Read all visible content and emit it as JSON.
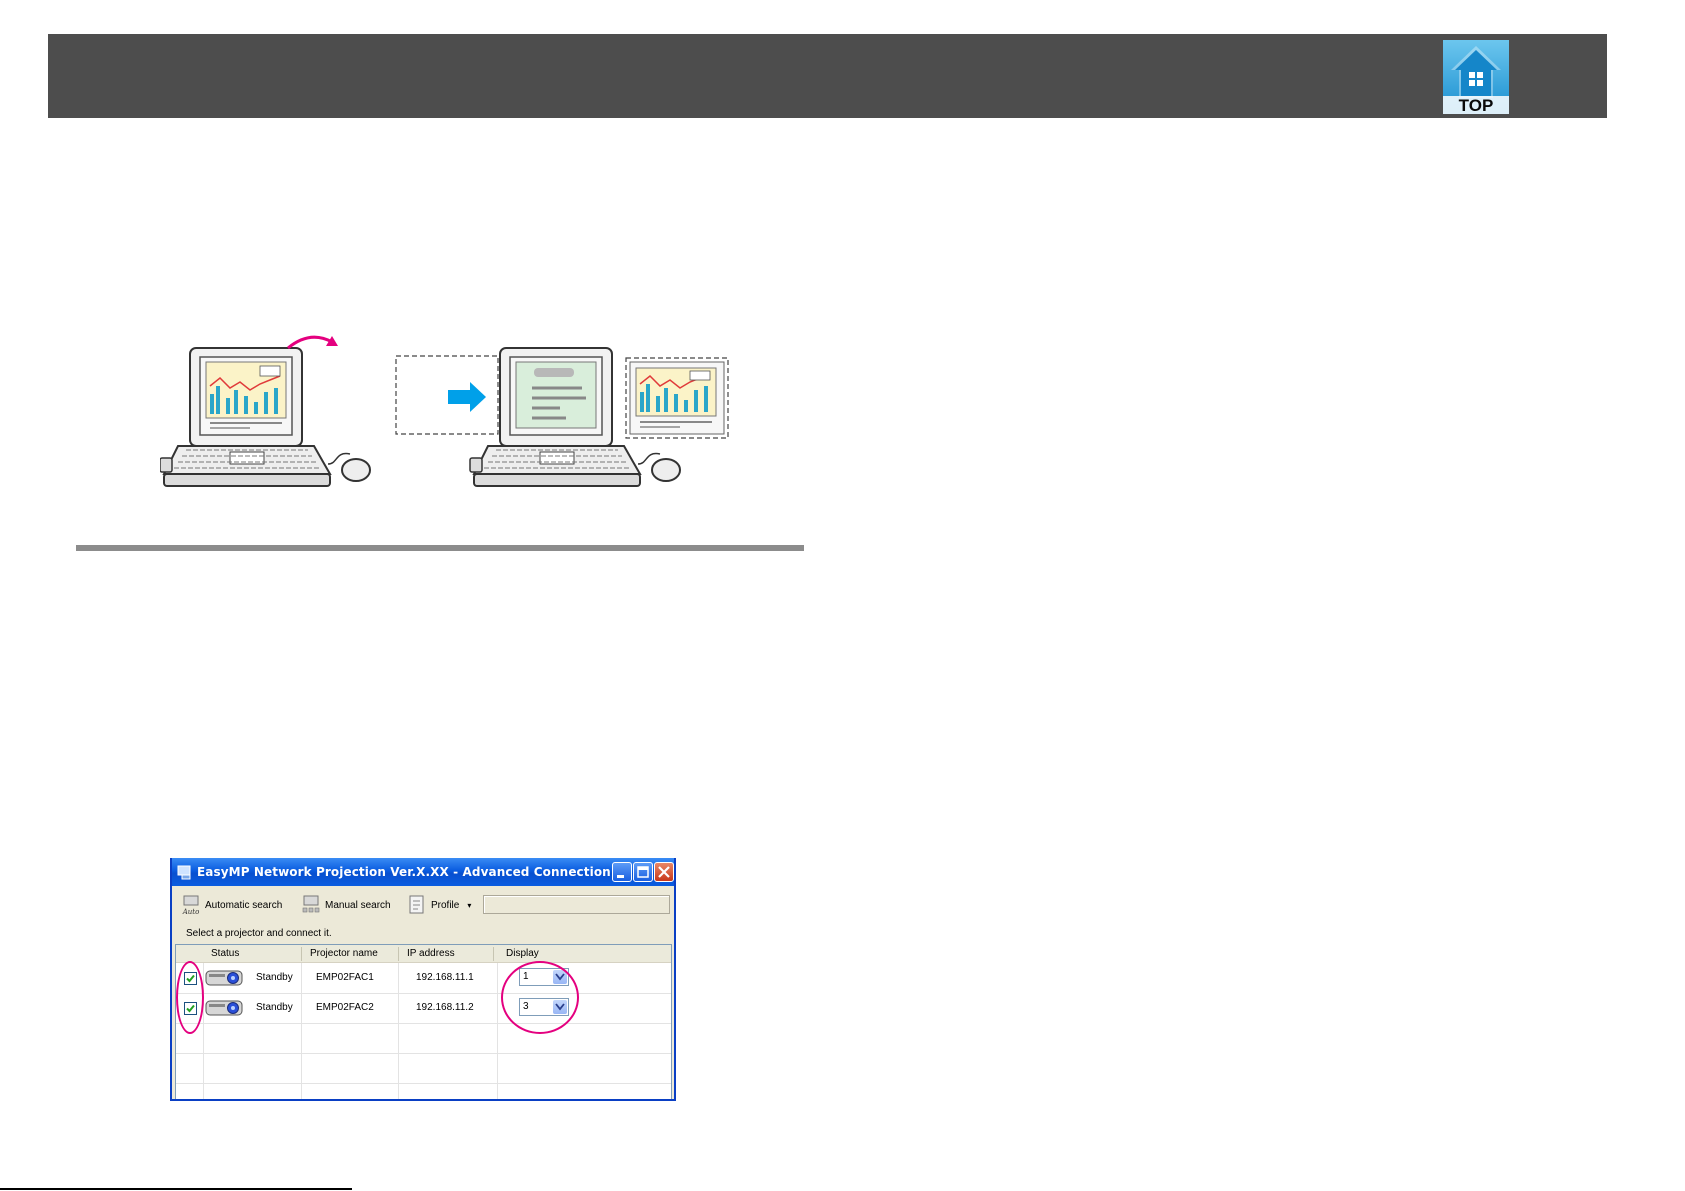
{
  "header": {
    "top_icon_label": "TOP",
    "band_color": "#4d4d4d"
  },
  "illustration": {
    "accent_color": "#00a0e9",
    "arrow_icon": "right-arrow-icon",
    "curve_icon": "curved-arrow-icon"
  },
  "window": {
    "title": "EasyMP Network Projection Ver.X.XX - Advanced Connection -",
    "toolbar": {
      "auto_icon_text": "Auto",
      "automatic_search": "Automatic search",
      "manual_search": "Manual search",
      "profile": "Profile",
      "profile_arrow": "▾",
      "profile_value": ""
    },
    "instruction": "Select a projector and connect it.",
    "columns": {
      "status": "Status",
      "projector_name": "Projector name",
      "ip_address": "IP address",
      "display": "Display"
    },
    "rows": [
      {
        "checked": true,
        "status": "Standby",
        "projector_name": "EMP02FAC1",
        "ip_address": "192.168.11.1",
        "display": "1"
      },
      {
        "checked": true,
        "status": "Standby",
        "projector_name": "EMP02FAC2",
        "ip_address": "192.168.11.2",
        "display": "3"
      }
    ]
  },
  "callout_color": "#e4007f"
}
